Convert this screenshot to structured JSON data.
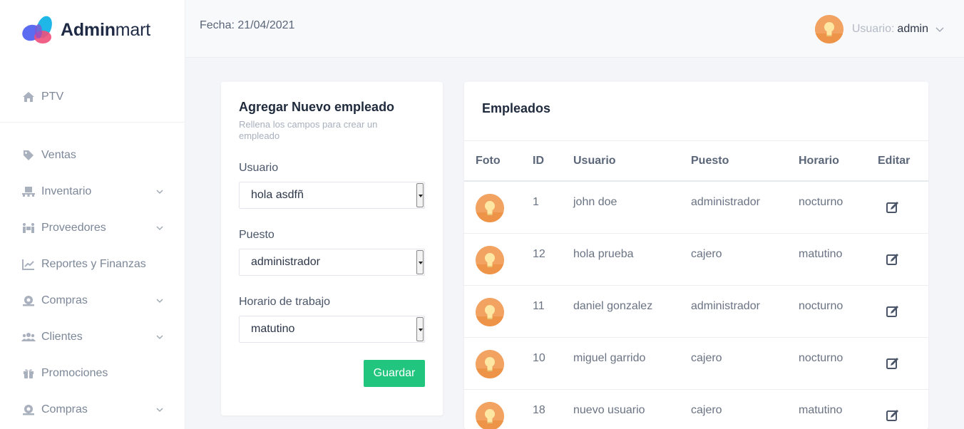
{
  "brand": {
    "name_bold": "Admin",
    "name_light": "mart"
  },
  "topbar": {
    "date": "Fecha: 21/04/2021",
    "user_label": "Usuario:",
    "user_name": "admin"
  },
  "sidebar": {
    "items": [
      {
        "label": "PTV",
        "icon": "home-icon",
        "chevron": false
      },
      {
        "label": "Ventas",
        "icon": "tag-icon",
        "chevron": false
      },
      {
        "label": "Inventario",
        "icon": "pallet-icon",
        "chevron": true
      },
      {
        "label": "Proveedores",
        "icon": "people-carry-icon",
        "chevron": true
      },
      {
        "label": "Reportes y Finanzas",
        "icon": "chart-line-icon",
        "chevron": false
      },
      {
        "label": "Compras",
        "icon": "money-bill-icon",
        "chevron": true
      },
      {
        "label": "Clientes",
        "icon": "users-icon",
        "chevron": true
      },
      {
        "label": "Promociones",
        "icon": "gift-icon",
        "chevron": false
      },
      {
        "label": "Compras",
        "icon": "money-bill-icon",
        "chevron": true
      }
    ]
  },
  "form": {
    "title": "Agregar Nuevo empleado",
    "subtitle": "Rellena los campos para crear un empleado",
    "fields": [
      {
        "label": "Usuario",
        "value": "hola asdfñ"
      },
      {
        "label": "Puesto",
        "value": "administrador"
      },
      {
        "label": "Horario de trabajo",
        "value": "matutino"
      }
    ],
    "submit_label": "Guardar"
  },
  "table": {
    "title": "Empleados",
    "columns": [
      "Foto",
      "ID",
      "Usuario",
      "Puesto",
      "Horario",
      "Editar"
    ],
    "rows": [
      {
        "id": "1",
        "usuario": "john doe",
        "puesto": "administrador",
        "horario": "nocturno"
      },
      {
        "id": "12",
        "usuario": "hola prueba",
        "puesto": "cajero",
        "horario": "matutino"
      },
      {
        "id": "11",
        "usuario": "daniel gonzalez",
        "puesto": "administrador",
        "horario": "nocturno"
      },
      {
        "id": "10",
        "usuario": "miguel garrido",
        "puesto": "cajero",
        "horario": "nocturno"
      },
      {
        "id": "18",
        "usuario": "nuevo usuario",
        "puesto": "cajero",
        "horario": "matutino"
      }
    ]
  },
  "colors": {
    "accent_green": "#22c57d",
    "avatar_orange": "#f2a261",
    "sidebar_text": "#7c8798"
  }
}
